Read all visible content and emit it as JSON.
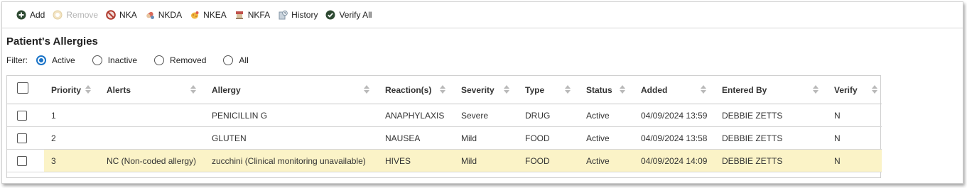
{
  "toolbar": {
    "items": [
      {
        "label": "Add",
        "icon": "add-icon",
        "enabled": true
      },
      {
        "label": "Remove",
        "icon": "remove-icon",
        "enabled": false
      },
      {
        "label": "NKA",
        "icon": "nka-icon",
        "enabled": true
      },
      {
        "label": "NKDA",
        "icon": "nkda-icon",
        "enabled": true
      },
      {
        "label": "NKEA",
        "icon": "nkea-icon",
        "enabled": true
      },
      {
        "label": "NKFA",
        "icon": "nkfa-icon",
        "enabled": true
      },
      {
        "label": "History",
        "icon": "history-icon",
        "enabled": true
      },
      {
        "label": "Verify All",
        "icon": "verify-all-icon",
        "enabled": true
      }
    ]
  },
  "title": "Patient's Allergies",
  "filter": {
    "label": "Filter:",
    "options": [
      "Active",
      "Inactive",
      "Removed",
      "All"
    ],
    "selected": "Active"
  },
  "table": {
    "columns": [
      "Priority",
      "Alerts",
      "Allergy",
      "Reaction(s)",
      "Severity",
      "Type",
      "Status",
      "Added",
      "Entered By",
      "Verify"
    ],
    "rows": [
      [
        "1",
        "",
        "PENICILLIN G",
        "ANAPHYLAXIS",
        "Severe",
        "DRUG",
        "Active",
        "04/09/2024 13:59",
        "DEBBIE ZETTS",
        "N"
      ],
      [
        "2",
        "",
        "GLUTEN",
        "NAUSEA",
        "Mild",
        "FOOD",
        "Active",
        "04/09/2024 13:58",
        "DEBBIE ZETTS",
        "N"
      ],
      [
        "3",
        "NC (Non-coded allergy)",
        "zucchini (Clinical monitoring unavailable)",
        "HIVES",
        "Mild",
        "FOOD",
        "Active",
        "04/09/2024 14:09",
        "DEBBIE ZETTS",
        "N"
      ]
    ],
    "selected_row": 2
  },
  "colors": {
    "accent": "#1a73c7",
    "selected_row": "#fbf3c7",
    "add_icon": "#2e4a32",
    "verify_icon": "#2e4a32",
    "nka_icon": "#b03a2e"
  }
}
